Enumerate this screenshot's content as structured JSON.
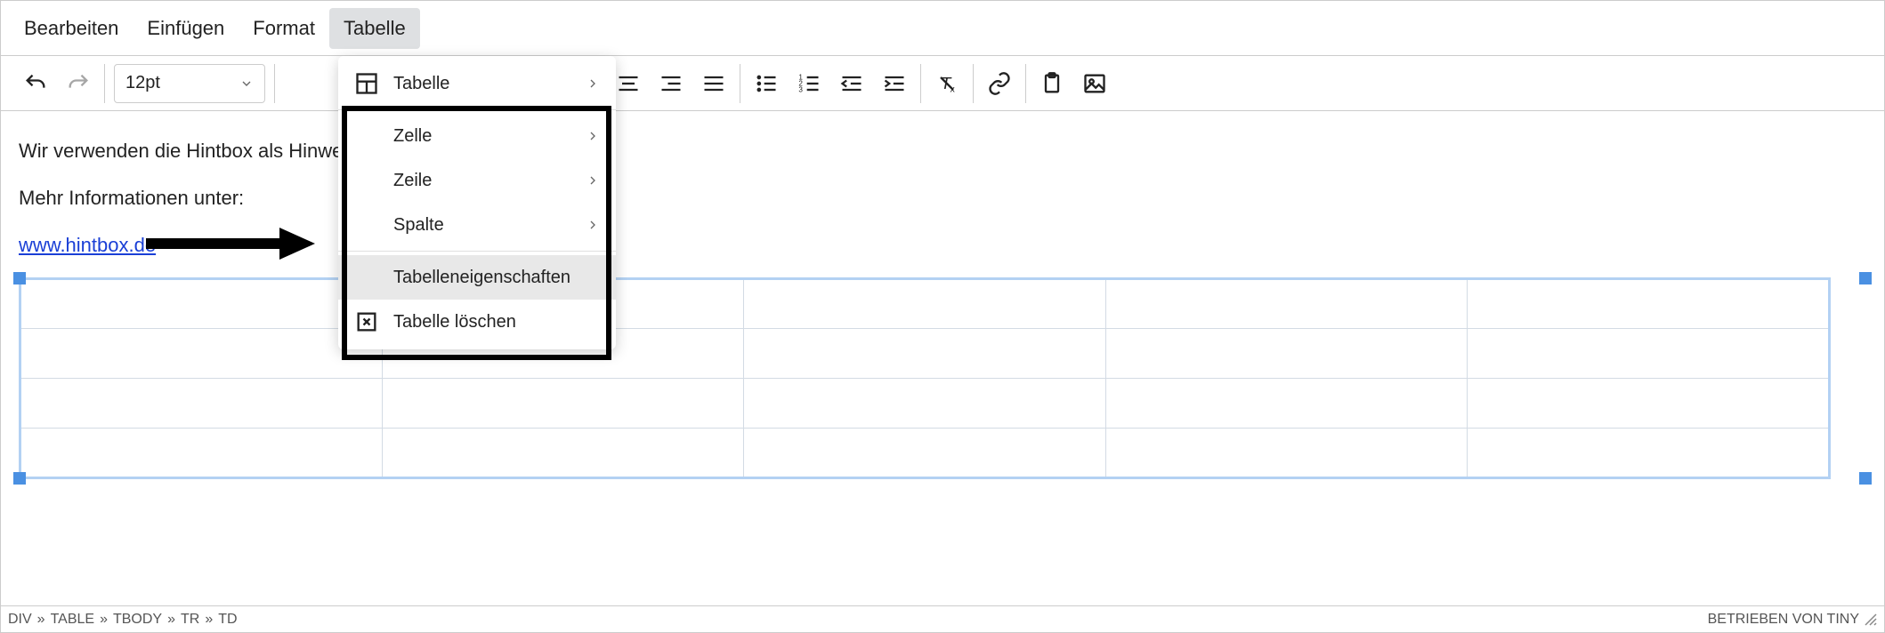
{
  "menubar": {
    "edit": "Bearbeiten",
    "insert": "Einfügen",
    "format": "Format",
    "table": "Tabelle"
  },
  "toolbar": {
    "fontsize": "12pt"
  },
  "dropdown": {
    "table": "Tabelle",
    "cell": "Zelle",
    "row": "Zeile",
    "col": "Spalte",
    "props": "Tabelleneigenschaften",
    "delete": "Tabelle löschen"
  },
  "content": {
    "line1": "Wir verwenden die Hintbox als Hinweisgebersystem.",
    "line2": "Mehr Informationen unter:",
    "link": "www.hintbox.de"
  },
  "statusbar": {
    "p1": "DIV",
    "p2": "TABLE",
    "p3": "TBODY",
    "p4": "TR",
    "p5": "TD",
    "powered": "BETRIEBEN VON TINY"
  }
}
